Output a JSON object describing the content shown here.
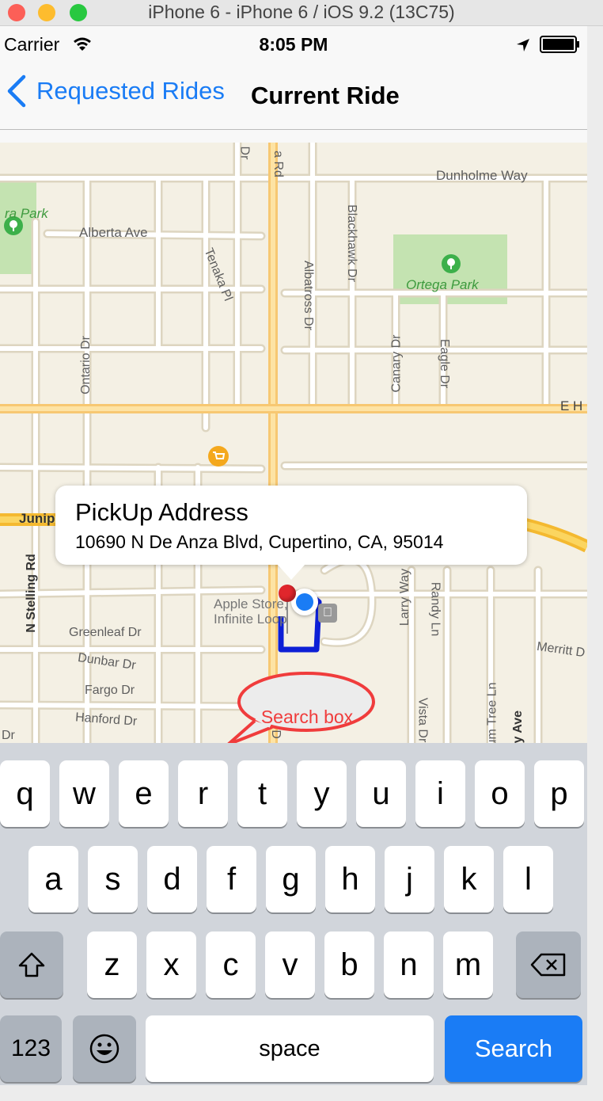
{
  "window": {
    "title": "iPhone 6 - iPhone 6 / iOS 9.2 (13C75)",
    "lights": [
      "#fc5f57",
      "#fdbc2e",
      "#28c840"
    ]
  },
  "status_bar": {
    "carrier": "Carrier",
    "time": "8:05 PM"
  },
  "nav": {
    "back_label": "Requested Rides",
    "title": "Current Ride"
  },
  "map": {
    "streets": [
      "Dr",
      "a Rd",
      "Dunholme Way",
      "Blackhawk Dr",
      "Alberta Ave",
      "Tenaka Pl",
      "Albatross Dr",
      "Ontario Dr",
      "Canary Dr",
      "Eagle Dr",
      "E H",
      "Junipe",
      "N Stelling Rd",
      "Greenleaf Dr",
      "Dunbar Dr",
      "Fargo Dr",
      "Hanford Dr",
      "Dr",
      "D",
      "Larry Way",
      "Randy Ln",
      "Vista Dr",
      "Plum Tree Ln",
      "ney Ave",
      "Merritt D",
      "Dr"
    ],
    "parks": [
      "ra Park",
      "Ortega Park"
    ],
    "poi": "Apple Store, Infinite Loop",
    "callout": {
      "title": "PickUp Address",
      "address": "10690 N De Anza Blvd, Cupertino, CA, 95014"
    },
    "annotation": "Search box",
    "route_color": "#0d1fd6",
    "annotation_border": "#f03c3c"
  },
  "keyboard": {
    "row1": [
      "q",
      "w",
      "e",
      "r",
      "t",
      "y",
      "u",
      "i",
      "o",
      "p"
    ],
    "row2": [
      "a",
      "s",
      "d",
      "f",
      "g",
      "h",
      "j",
      "k",
      "l"
    ],
    "row3": [
      "z",
      "x",
      "c",
      "v",
      "b",
      "n",
      "m"
    ],
    "numbers": "123",
    "space": "space",
    "search": "Search"
  }
}
